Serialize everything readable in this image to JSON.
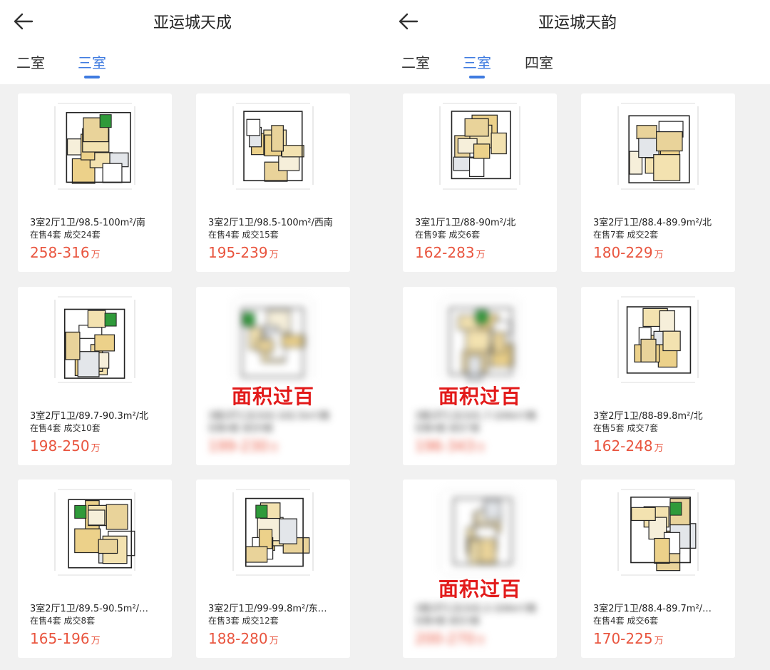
{
  "colors": {
    "accent": "#3f7be0",
    "price": "#e9553f",
    "stamp": "#e21a1a",
    "background": "#f1f1f1"
  },
  "left": {
    "title": "亚运城天成",
    "tabs": [
      {
        "label": "二室"
      },
      {
        "label": "三室",
        "active": true
      }
    ],
    "cards": [
      {
        "desc": "3室2厅1卫/98.5-100m²/南",
        "stats": "在售4套 成交24套",
        "price": "258-316",
        "unit": "万"
      },
      {
        "desc": "3室2厅1卫/98.5-100m²/西南",
        "stats": "在售4套 成交15套",
        "price": "195-239",
        "unit": "万"
      },
      {
        "desc": "3室2厅1卫/89.7-90.3m²/北",
        "stats": "在售4套 成交10套",
        "price": "198-250",
        "unit": "万"
      },
      {
        "desc": "3室2厅1卫/102-102.5m²/南",
        "stats": "在售4套 成交9套",
        "price": "199-230",
        "unit": "万",
        "overlay": "面积过百"
      },
      {
        "desc": "3室2厅1卫/89.5-90.5m²/…",
        "stats": "在售4套 成交8套",
        "price": "165-196",
        "unit": "万"
      },
      {
        "desc": "3室2厅1卫/99-99.8m²/东…",
        "stats": "在售3套 成交12套",
        "price": "188-280",
        "unit": "万"
      }
    ]
  },
  "right": {
    "title": "亚运城天韵",
    "tabs": [
      {
        "label": "二室"
      },
      {
        "label": "三室",
        "active": true
      },
      {
        "label": "四室"
      }
    ],
    "cards": [
      {
        "desc": "3室1厅1卫/88-90m²/北",
        "stats": "在售9套 成交6套",
        "price": "162-283",
        "unit": "万"
      },
      {
        "desc": "3室2厅1卫/88.4-89.9m²/北",
        "stats": "在售7套 成交2套",
        "price": "180-229",
        "unit": "万"
      },
      {
        "desc": "3室2厅1卫/101.7-104m²/南",
        "stats": "在售4套 成交7套",
        "price": "196-343",
        "unit": "万",
        "overlay": "面积过百"
      },
      {
        "desc": "3室2厅1卫/88-89.8m²/北",
        "stats": "在售5套 成交7套",
        "price": "162-248",
        "unit": "万"
      },
      {
        "desc": "3室2厅1卫/102.2-104m²/南",
        "stats": "在售4套 成交3套",
        "price": "200-270",
        "unit": "万",
        "overlay": "面积过百"
      },
      {
        "desc": "3室2厅1卫/88.4-89.7m²/…",
        "stats": "在售4套 成交6套",
        "price": "170-225",
        "unit": "万"
      }
    ]
  }
}
